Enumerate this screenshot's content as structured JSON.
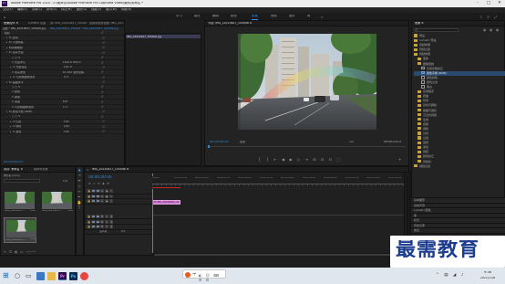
{
  "titlebar": {
    "title": "Adobe Premiere Pro 2020 - E:\\美术手\\Adobe Premiere Pro Captured Video\\案例\\未命名 *",
    "app_icon": "Pr"
  },
  "menubar": [
    "文件(F)",
    "编辑(E)",
    "剪辑(C)",
    "序列(S)",
    "标记(M)",
    "图形(G)",
    "视图(V)",
    "窗口(W)",
    "帮助(H)"
  ],
  "workspaces": {
    "items": [
      "学习",
      "组件",
      "编辑",
      "颜色",
      "效果",
      "音频",
      "图形",
      "库"
    ],
    "active": "效果"
  },
  "effect_controls": {
    "tabs": [
      "效果控件 ≡",
      "Lumetri 范围",
      "源: IMG_20210817_155406.jpg",
      "音频剪辑混合器: IMG_20210817"
    ],
    "source_row": {
      "master": "主要 * IMG_20210817_155406.jpg",
      "clip": "IMG_20210817_155406 * IMG_20210817_155406.jpg"
    },
    "lines": [
      {
        "label": "视频",
        "indent": 0,
        "tri": "",
        "value": ""
      },
      {
        "label": "fx 运动",
        "indent": 1,
        "tri": "▸",
        "value": ""
      },
      {
        "label": "fx 不透明度",
        "indent": 1,
        "tri": "▸",
        "value": ""
      },
      {
        "label": "时间重映射",
        "indent": 1,
        "tri": "▸",
        "value": ""
      },
      {
        "label": "fx 镜头光晕",
        "indent": 1,
        "tri": "▾",
        "value": ""
      },
      {
        "label": "○ □ ✎",
        "indent": 2,
        "tri": "",
        "value": ""
      },
      {
        "label": "⊙ 光晕中心",
        "indent": 2,
        "tri": "",
        "value": "1300.6  950.0"
      },
      {
        "label": "⊙ 光晕亮度",
        "indent": 2,
        "tri": "▸",
        "value": "100 %"
      },
      {
        "label": "⊙ 镜头类型",
        "indent": 2,
        "tri": "",
        "value": "50-300 毫米变焦"
      },
      {
        "label": "⊙ 与原始图像混合",
        "indent": 2,
        "tri": "▸",
        "value": "0 %"
      },
      {
        "label": "fx 画面水平",
        "indent": 1,
        "tri": "▾",
        "value": ""
      },
      {
        "label": "○ □ ✎",
        "indent": 2,
        "tri": "",
        "value": ""
      },
      {
        "label": "⊙ 颜色",
        "indent": 2,
        "tri": "",
        "value": ""
      },
      {
        "label": "⊙ 颜色",
        "indent": 2,
        "tri": "",
        "value": ""
      },
      {
        "label": "⊙ 亮度",
        "indent": 2,
        "tri": "",
        "value": "100"
      },
      {
        "label": "⊙ 与原始图像混合",
        "indent": 2,
        "tri": "",
        "value": "0 %"
      },
      {
        "label": "fx 颜色平衡 (RGB)",
        "indent": 1,
        "tri": "▾",
        "value": ""
      },
      {
        "label": "○ □ ✎",
        "indent": 2,
        "tri": "",
        "value": ""
      },
      {
        "label": "⊙ 红色",
        "indent": 2,
        "tri": "▸",
        "value": "100"
      },
      {
        "label": "⊙ 绿色",
        "indent": 2,
        "tri": "▸",
        "value": "100"
      },
      {
        "label": "⊙ 蓝色",
        "indent": 2,
        "tri": "▸",
        "value": "100"
      }
    ],
    "timecode": "00:00:00:00"
  },
  "source_mini": {
    "header": "IMG_20210817_155406",
    "clip_label": "IMG_20210817_155406.jpg"
  },
  "program": {
    "tab": "节目: IMG_20210817_155406 ≡",
    "timecode_left": "00:00:00:00",
    "fit": "适合",
    "resolution": "1/2",
    "timecode_right": "00:00:23:13",
    "transport": [
      "⇤",
      "{",
      "}",
      "⇥",
      "◀",
      "▶",
      "▷",
      "⇥",
      "⊞",
      "⊟",
      "⊡",
      "⬚"
    ]
  },
  "effects_panel": {
    "tab": "效果 ≡",
    "tree": [
      {
        "label": "预设",
        "indent": 0,
        "type": "folder",
        "sel": false
      },
      {
        "label": "Lumetri 预设",
        "indent": 0,
        "type": "folder",
        "sel": false
      },
      {
        "label": "音频效果",
        "indent": 0,
        "type": "folder",
        "sel": false
      },
      {
        "label": "音频过渡",
        "indent": 0,
        "type": "folder",
        "sel": false
      },
      {
        "label": "视频效果",
        "indent": 0,
        "type": "folder",
        "sel": false
      },
      {
        "label": "变换",
        "indent": 1,
        "type": "folder",
        "sel": false
      },
      {
        "label": "图像控制",
        "indent": 1,
        "type": "folder",
        "sel": false
      },
      {
        "label": "灰度系数校正",
        "indent": 2,
        "type": "fx",
        "sel": false
      },
      {
        "label": "颜色平衡 (RGB)",
        "indent": 2,
        "type": "fx",
        "sel": true
      },
      {
        "label": "颜色替换",
        "indent": 2,
        "type": "fx",
        "sel": false
      },
      {
        "label": "颜色过滤",
        "indent": 2,
        "type": "fx",
        "sel": false
      },
      {
        "label": "黑白",
        "indent": 2,
        "type": "fx",
        "sel": false
      },
      {
        "label": "实用程序",
        "indent": 1,
        "type": "folder",
        "sel": false
      },
      {
        "label": "扭曲",
        "indent": 1,
        "type": "folder",
        "sel": false
      },
      {
        "label": "时间",
        "indent": 1,
        "type": "folder",
        "sel": false
      },
      {
        "label": "杂色与颗粒",
        "indent": 1,
        "type": "folder",
        "sel": false
      },
      {
        "label": "模糊与锐化",
        "indent": 1,
        "type": "folder",
        "sel": false
      },
      {
        "label": "沉浸式视频",
        "indent": 1,
        "type": "folder",
        "sel": false
      },
      {
        "label": "生成",
        "indent": 1,
        "type": "folder",
        "sel": false
      },
      {
        "label": "视频",
        "indent": 1,
        "type": "folder",
        "sel": false
      },
      {
        "label": "调整",
        "indent": 1,
        "type": "folder",
        "sel": false
      },
      {
        "label": "过时",
        "indent": 1,
        "type": "folder",
        "sel": false
      },
      {
        "label": "过渡",
        "indent": 1,
        "type": "folder",
        "sel": false
      },
      {
        "label": "透视",
        "indent": 1,
        "type": "folder",
        "sel": false
      },
      {
        "label": "通道",
        "indent": 1,
        "type": "folder",
        "sel": false
      },
      {
        "label": "键控",
        "indent": 1,
        "type": "folder",
        "sel": false
      },
      {
        "label": "颜色校正",
        "indent": 1,
        "type": "folder",
        "sel": false
      },
      {
        "label": "风格化",
        "indent": 1,
        "type": "folder",
        "sel": false
      },
      {
        "label": "视频过渡",
        "indent": 0,
        "type": "folder",
        "sel": false
      }
    ],
    "subpanels": [
      "基本图形",
      "基本声音",
      "Lumetri 颜色",
      "库",
      "标记",
      "历史记录",
      "信息"
    ]
  },
  "project": {
    "tabs": [
      "项目: 未命名 ≡",
      "媒体浏览器"
    ],
    "name": "未命名.prproj",
    "count": "2 项",
    "items": [
      {
        "label": "IMG_20210817...",
        "dur": "5:00"
      },
      {
        "label": "IMG_20210817...",
        "dur": "5:00"
      },
      {
        "label": "IMG_20210817...",
        "dur": "5:00"
      }
    ]
  },
  "timeline": {
    "tab": "IMG_20210817_155406 ≡",
    "timecode": "00:00:00:00",
    "ruler": [
      ":00:00",
      "00:00:15:00",
      "00:00:30:00",
      "00:00:45:00",
      "00:01:00:00",
      "00:01:15:00",
      "00:01:30:00",
      "00:01:45:00",
      "00:02:00:00",
      "00:02:15:00",
      "00:02:30:00",
      "00:02:45:00"
    ],
    "tracks": [
      {
        "name": "V3",
        "kind": "v"
      },
      {
        "name": "V2",
        "kind": "v"
      },
      {
        "name": "V1",
        "kind": "v"
      },
      {
        "name": "A1",
        "kind": "a"
      },
      {
        "name": "A2",
        "kind": "a"
      },
      {
        "name": "A3",
        "kind": "a"
      }
    ],
    "master": "主声道",
    "master_value": "0.0",
    "clip_label": "fx IMG_20210817_15"
  },
  "watermark": "最需教育",
  "taskbar": {
    "time": "9:36",
    "date": "2021/11/8",
    "lang": "中",
    "items": [
      "start-icon",
      "search-icon",
      "taskview-icon",
      "explorer-icon",
      "folder-icon",
      "pr-icon",
      "ps-icon",
      "chrome-icon"
    ]
  },
  "colors": {
    "accent": "#2f8de0",
    "clip": "#d07fd0",
    "selection": "#3c6da6"
  }
}
